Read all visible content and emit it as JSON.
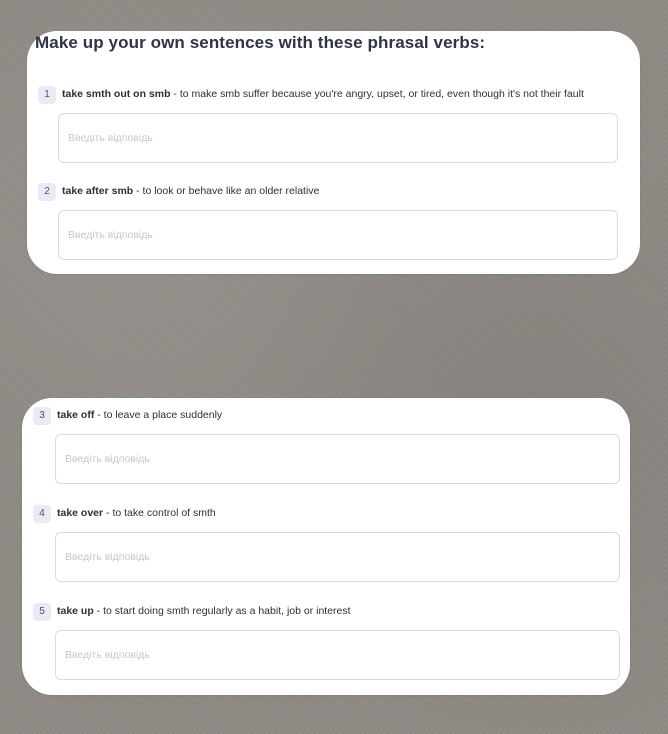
{
  "heading": "Make up your own sentences with these phrasal verbs:",
  "questions": [
    {
      "number": "1",
      "phrase": "take smth out on smb",
      "definition": " - to make smb suffer because you're angry, upset, or tired, even though it's not their fault",
      "placeholder": "Введіть відповідь"
    },
    {
      "number": "2",
      "phrase": "take after smb",
      "definition": " - to look or behave like an older relative",
      "placeholder": "Введіть відповідь"
    },
    {
      "number": "3",
      "phrase": "take off",
      "definition": " - to leave a place suddenly",
      "placeholder": "Введіть відповідь"
    },
    {
      "number": "4",
      "phrase": "take over",
      "definition": " - to take control of smth",
      "placeholder": "Введіть відповідь"
    },
    {
      "number": "5",
      "phrase": "take up",
      "definition": " - to start doing smth regularly as a habit, job or interest",
      "placeholder": "Введіть відповідь"
    }
  ]
}
